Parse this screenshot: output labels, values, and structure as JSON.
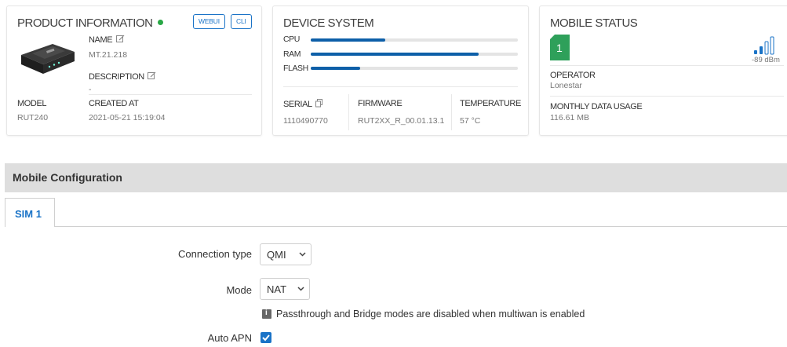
{
  "product": {
    "title": "PRODUCT INFORMATION",
    "webui_label": "WEBUI",
    "cli_label": "CLI",
    "name_label": "NAME",
    "name_value": "MT.21.218",
    "description_label": "DESCRIPTION",
    "description_value": "-",
    "model_label": "MODEL",
    "model_value": "RUT240",
    "created_label": "CREATED AT",
    "created_value": "2021-05-21 15:19:04",
    "status_color": "#28a745"
  },
  "device": {
    "title": "DEVICE SYSTEM",
    "bars": [
      {
        "label": "CPU",
        "fill": 0.36
      },
      {
        "label": "RAM",
        "fill": 0.81
      },
      {
        "label": "FLASH",
        "fill": 0.24
      }
    ],
    "serial_label": "SERIAL",
    "serial_value": "1110490770",
    "firmware_label": "FIRMWARE",
    "firmware_value": "RUT2XX_R_00.01.13.1",
    "temperature_label": "TEMPERATURE",
    "temperature_value": "57 °C"
  },
  "mobile": {
    "title": "MOBILE STATUS",
    "sim_number": "1",
    "signal": "-89 dBm",
    "operator_label": "OPERATOR",
    "operator_value": "Lonestar",
    "usage_label": "MONTHLY DATA USAGE",
    "usage_value": "116.61 MB",
    "sim_color": "#2ea05a"
  },
  "config": {
    "section_title": "Mobile Configuration",
    "tab_label": "SIM 1",
    "connection_type_label": "Connection type",
    "connection_type_value": "QMI",
    "mode_label": "Mode",
    "mode_value": "NAT",
    "mode_note": "Passthrough and Bridge modes are disabled when multiwan is enabled",
    "auto_apn_label": "Auto APN",
    "auto_apn_checked": true
  }
}
